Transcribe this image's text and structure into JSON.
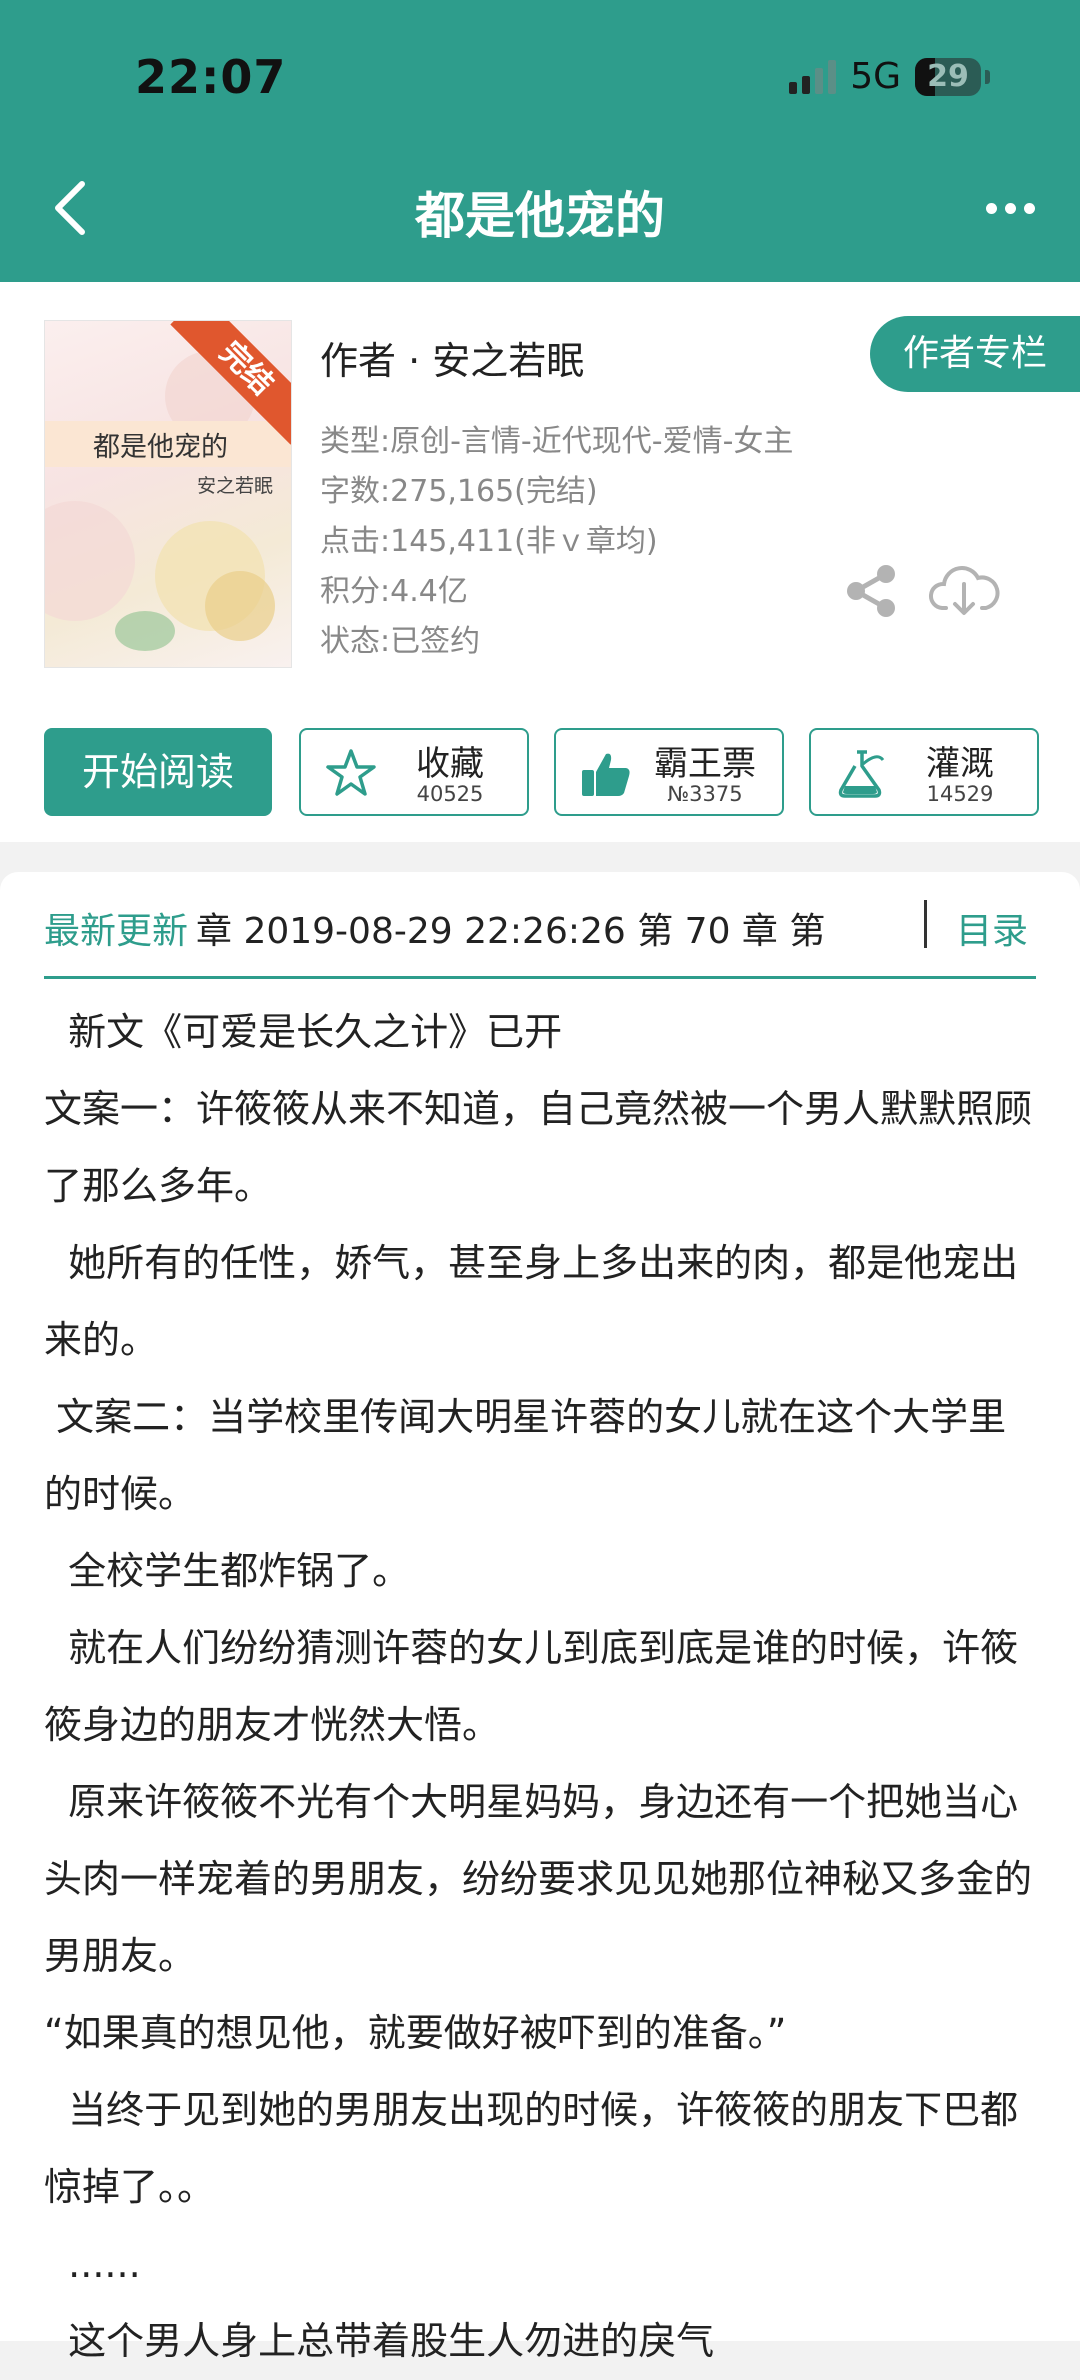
{
  "status_bar": {
    "time": "22:07",
    "network": "5G",
    "battery": "29"
  },
  "header": {
    "title": "都是他宠的",
    "back_icon": "chevron-left-icon",
    "more_icon": "more-dots-icon"
  },
  "book": {
    "cover_title": "都是他宠的",
    "cover_author": "安之若眠",
    "cover_ribbon": "完结",
    "author_line": "作者 · 安之若眠",
    "author_column_button": "作者专栏",
    "meta": [
      "类型:原创-言情-近代现代-爱情-女主",
      "字数:275,165(完结)",
      "点击:145,411(非ｖ章均)",
      "积分:4.4亿",
      "状态:已签约"
    ]
  },
  "actions": {
    "read_button": "开始阅读",
    "favorite": {
      "label": "收藏",
      "count": "40525",
      "icon": "star-icon"
    },
    "vote": {
      "label": "霸王票",
      "count": "№3375",
      "icon": "thumbs-up-icon"
    },
    "water": {
      "label": "灌溉",
      "count": "14529",
      "icon": "watering-flask-icon"
    }
  },
  "latest_update": {
    "label": "最新更新",
    "text": "章 2019-08-29 22:26:26   第 70 章  第",
    "toc": "目录"
  },
  "summary": [
    "  新文《可爱是长久之计》已开",
    "文案一：许筱筱从来不知道，自己竟然被一个男人默默照顾了那么多年。",
    "  她所有的任性，娇气，甚至身上多出来的肉，都是他宠出来的。",
    " 文案二：当学校里传闻大明星许蓉的女儿就在这个大学里的时候。",
    "  全校学生都炸锅了。",
    "  就在人们纷纷猜测许蓉的女儿到底到底是谁的时候，许筱筱身边的朋友才恍然大悟。",
    "  原来许筱筱不光有个大明星妈妈，身边还有一个把她当心头肉一样宠着的男朋友，纷纷要求见见她那位神秘又多金的男朋友。",
    "“如果真的想见他，就要做好被吓到的准备。”",
    "  当终于见到她的男朋友出现的时候，许筱筱的朋友下巴都惊掉了。。",
    "  ......",
    "  这个男人身上总带着股生人勿进的戾气"
  ],
  "colors": {
    "accent": "#2e9d8c",
    "ribbon": "#e0572e"
  }
}
